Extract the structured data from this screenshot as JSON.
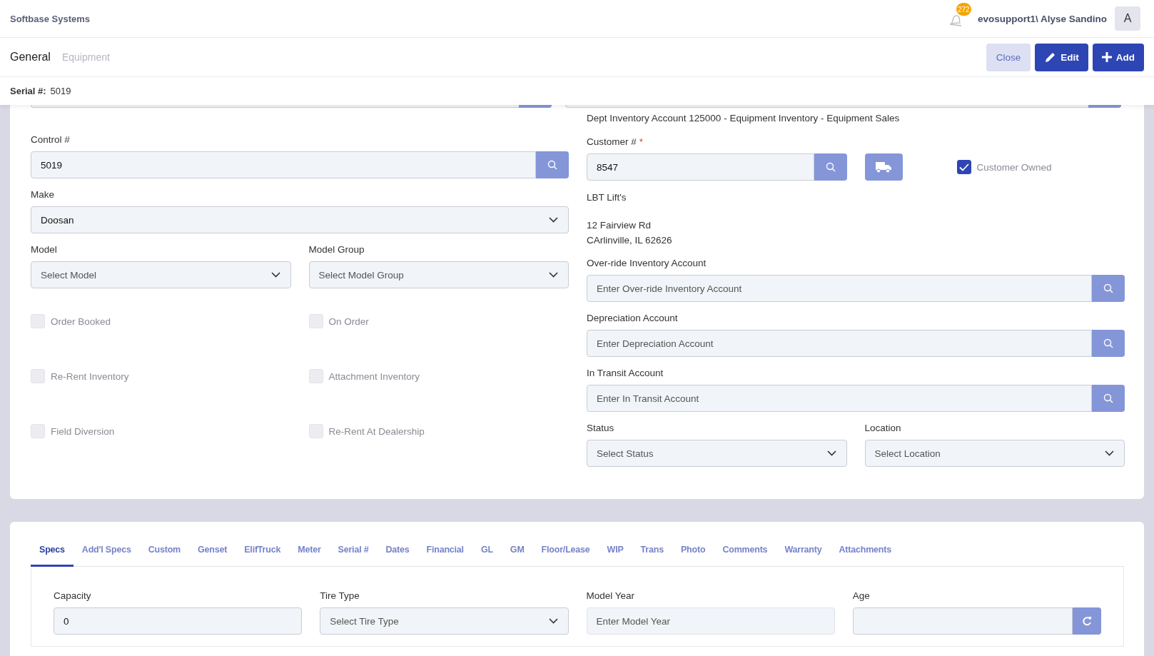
{
  "app": {
    "title": "Softbase Systems",
    "notification_count": "272",
    "user": "evosupport1\\ Alyse Sandino",
    "avatar": "A"
  },
  "header": {
    "tabs": [
      {
        "label": "General",
        "selected": true
      },
      {
        "label": "Equipment",
        "selected": false
      }
    ],
    "buttons": [
      {
        "label": "Close",
        "kind": "secondary"
      },
      {
        "label": "Edit",
        "kind": "edit"
      },
      {
        "label": "Add",
        "kind": "add"
      }
    ]
  },
  "serial": {
    "label": "Serial #:",
    "value": "5019"
  },
  "form": {
    "account_note": "Dept Inventory Account 125000 - Equipment Inventory - Equipment Sales",
    "control": {
      "label": "Control #",
      "value": "5019"
    },
    "make": {
      "label": "Make",
      "value": "Doosan"
    },
    "model": {
      "label": "Model",
      "placeholder": "Select Model"
    },
    "model_group": {
      "label": "Model Group",
      "placeholder": "Select Model Group"
    },
    "checkboxes": [
      {
        "label": "Order Booked",
        "checked": false
      },
      {
        "label": "On Order",
        "checked": false
      },
      {
        "label": "Re-Rent Inventory",
        "checked": false
      },
      {
        "label": "Attachment Inventory",
        "checked": false
      },
      {
        "label": "Field Diversion",
        "checked": false
      },
      {
        "label": "Re-Rent At Dealership",
        "checked": false
      }
    ],
    "customer": {
      "label": "Customer #",
      "required_mark": "*",
      "value": "8547"
    },
    "customer_owned": {
      "label": "Customer Owned",
      "checked": true
    },
    "customer_name": "LBT Lift's",
    "address": [
      "12 Fairview Rd",
      "CArlinville, IL 62626"
    ],
    "accounts": [
      {
        "label": "Over-ride Inventory Account",
        "placeholder": "Enter Over-ride Inventory Account"
      },
      {
        "label": "Depreciation Account",
        "placeholder": "Enter Depreciation Account"
      },
      {
        "label": "In Transit Account",
        "placeholder": "Enter In Transit Account"
      }
    ],
    "status": {
      "label": "Status",
      "placeholder": "Select Status"
    },
    "location": {
      "label": "Location",
      "placeholder": "Select Location"
    }
  },
  "detail_tabs": [
    {
      "label": "Specs",
      "selected": true
    },
    {
      "label": "Add'l Specs",
      "selected": false
    },
    {
      "label": "Custom",
      "selected": false
    },
    {
      "label": "Genset",
      "selected": false
    },
    {
      "label": "ElifTruck",
      "selected": false
    },
    {
      "label": "Meter",
      "selected": false
    },
    {
      "label": "Serial #",
      "selected": false
    },
    {
      "label": "Dates",
      "selected": false
    },
    {
      "label": "Financial",
      "selected": false
    },
    {
      "label": "GL",
      "selected": false
    },
    {
      "label": "GM",
      "selected": false
    },
    {
      "label": "Floor/Lease",
      "selected": false
    },
    {
      "label": "WIP",
      "selected": false
    },
    {
      "label": "Trans",
      "selected": false
    },
    {
      "label": "Photo",
      "selected": false
    },
    {
      "label": "Comments",
      "selected": false
    },
    {
      "label": "Warranty",
      "selected": false
    },
    {
      "label": "Attachments",
      "selected": false
    }
  ],
  "specs": [
    {
      "kind": "input",
      "label": "Capacity",
      "value": "0"
    },
    {
      "kind": "select",
      "label": "Tire Type",
      "placeholder": "Select Tire Type"
    },
    {
      "kind": "readonly",
      "label": "Model Year",
      "placeholder": "Enter Model Year"
    },
    {
      "kind": "refresh",
      "label": "Age"
    }
  ]
}
